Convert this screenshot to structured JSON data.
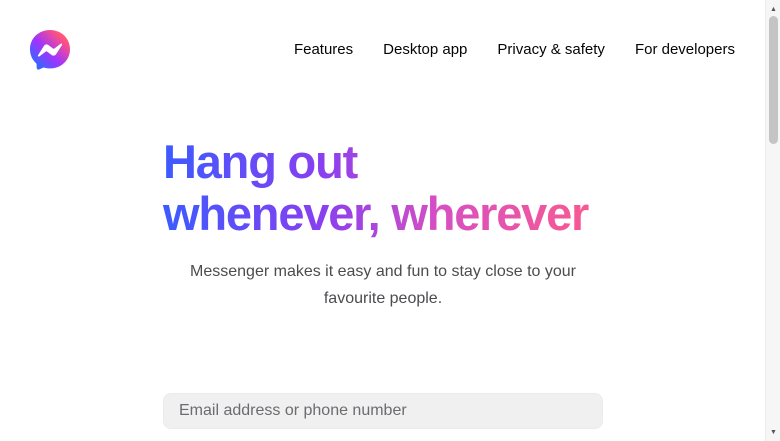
{
  "app": {
    "logo_icon": "messenger-logo-icon",
    "brand_gradient": [
      "#0a7cff",
      "#a033ff",
      "#ff5280",
      "#ff7061"
    ]
  },
  "nav": {
    "items": [
      {
        "label": "Features"
      },
      {
        "label": "Desktop app"
      },
      {
        "label": "Privacy & safety"
      },
      {
        "label": "For developers"
      }
    ]
  },
  "hero": {
    "title_line_1": "Hang out",
    "title_line_2": "whenever, wherever",
    "title_gradient": [
      "#3b5bff",
      "#8a3ff0",
      "#d74fc2",
      "#ff5c86"
    ],
    "subtitle": "Messenger makes it easy and fun to stay close to your favourite people."
  },
  "login": {
    "email_placeholder": "Email address or phone number",
    "email_value": ""
  },
  "scrollbar": {
    "up_icon": "scroll-up-arrow-icon",
    "down_icon": "scroll-down-arrow-icon"
  }
}
